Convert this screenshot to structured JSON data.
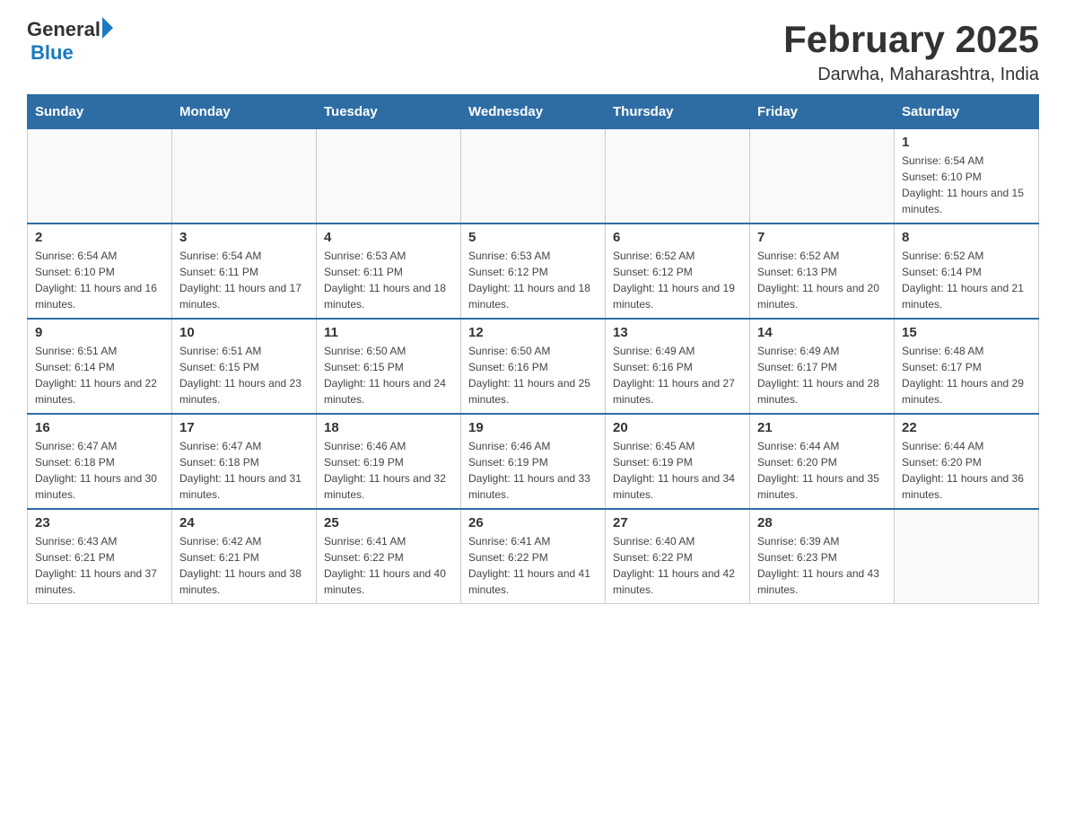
{
  "header": {
    "logo": {
      "text_general": "General",
      "text_blue": "Blue"
    },
    "title": "February 2025",
    "location": "Darwha, Maharashtra, India"
  },
  "days_of_week": [
    "Sunday",
    "Monday",
    "Tuesday",
    "Wednesday",
    "Thursday",
    "Friday",
    "Saturday"
  ],
  "weeks": [
    [
      {
        "day": "",
        "info": ""
      },
      {
        "day": "",
        "info": ""
      },
      {
        "day": "",
        "info": ""
      },
      {
        "day": "",
        "info": ""
      },
      {
        "day": "",
        "info": ""
      },
      {
        "day": "",
        "info": ""
      },
      {
        "day": "1",
        "info": "Sunrise: 6:54 AM\nSunset: 6:10 PM\nDaylight: 11 hours and 15 minutes."
      }
    ],
    [
      {
        "day": "2",
        "info": "Sunrise: 6:54 AM\nSunset: 6:10 PM\nDaylight: 11 hours and 16 minutes."
      },
      {
        "day": "3",
        "info": "Sunrise: 6:54 AM\nSunset: 6:11 PM\nDaylight: 11 hours and 17 minutes."
      },
      {
        "day": "4",
        "info": "Sunrise: 6:53 AM\nSunset: 6:11 PM\nDaylight: 11 hours and 18 minutes."
      },
      {
        "day": "5",
        "info": "Sunrise: 6:53 AM\nSunset: 6:12 PM\nDaylight: 11 hours and 18 minutes."
      },
      {
        "day": "6",
        "info": "Sunrise: 6:52 AM\nSunset: 6:12 PM\nDaylight: 11 hours and 19 minutes."
      },
      {
        "day": "7",
        "info": "Sunrise: 6:52 AM\nSunset: 6:13 PM\nDaylight: 11 hours and 20 minutes."
      },
      {
        "day": "8",
        "info": "Sunrise: 6:52 AM\nSunset: 6:14 PM\nDaylight: 11 hours and 21 minutes."
      }
    ],
    [
      {
        "day": "9",
        "info": "Sunrise: 6:51 AM\nSunset: 6:14 PM\nDaylight: 11 hours and 22 minutes."
      },
      {
        "day": "10",
        "info": "Sunrise: 6:51 AM\nSunset: 6:15 PM\nDaylight: 11 hours and 23 minutes."
      },
      {
        "day": "11",
        "info": "Sunrise: 6:50 AM\nSunset: 6:15 PM\nDaylight: 11 hours and 24 minutes."
      },
      {
        "day": "12",
        "info": "Sunrise: 6:50 AM\nSunset: 6:16 PM\nDaylight: 11 hours and 25 minutes."
      },
      {
        "day": "13",
        "info": "Sunrise: 6:49 AM\nSunset: 6:16 PM\nDaylight: 11 hours and 27 minutes."
      },
      {
        "day": "14",
        "info": "Sunrise: 6:49 AM\nSunset: 6:17 PM\nDaylight: 11 hours and 28 minutes."
      },
      {
        "day": "15",
        "info": "Sunrise: 6:48 AM\nSunset: 6:17 PM\nDaylight: 11 hours and 29 minutes."
      }
    ],
    [
      {
        "day": "16",
        "info": "Sunrise: 6:47 AM\nSunset: 6:18 PM\nDaylight: 11 hours and 30 minutes."
      },
      {
        "day": "17",
        "info": "Sunrise: 6:47 AM\nSunset: 6:18 PM\nDaylight: 11 hours and 31 minutes."
      },
      {
        "day": "18",
        "info": "Sunrise: 6:46 AM\nSunset: 6:19 PM\nDaylight: 11 hours and 32 minutes."
      },
      {
        "day": "19",
        "info": "Sunrise: 6:46 AM\nSunset: 6:19 PM\nDaylight: 11 hours and 33 minutes."
      },
      {
        "day": "20",
        "info": "Sunrise: 6:45 AM\nSunset: 6:19 PM\nDaylight: 11 hours and 34 minutes."
      },
      {
        "day": "21",
        "info": "Sunrise: 6:44 AM\nSunset: 6:20 PM\nDaylight: 11 hours and 35 minutes."
      },
      {
        "day": "22",
        "info": "Sunrise: 6:44 AM\nSunset: 6:20 PM\nDaylight: 11 hours and 36 minutes."
      }
    ],
    [
      {
        "day": "23",
        "info": "Sunrise: 6:43 AM\nSunset: 6:21 PM\nDaylight: 11 hours and 37 minutes."
      },
      {
        "day": "24",
        "info": "Sunrise: 6:42 AM\nSunset: 6:21 PM\nDaylight: 11 hours and 38 minutes."
      },
      {
        "day": "25",
        "info": "Sunrise: 6:41 AM\nSunset: 6:22 PM\nDaylight: 11 hours and 40 minutes."
      },
      {
        "day": "26",
        "info": "Sunrise: 6:41 AM\nSunset: 6:22 PM\nDaylight: 11 hours and 41 minutes."
      },
      {
        "day": "27",
        "info": "Sunrise: 6:40 AM\nSunset: 6:22 PM\nDaylight: 11 hours and 42 minutes."
      },
      {
        "day": "28",
        "info": "Sunrise: 6:39 AM\nSunset: 6:23 PM\nDaylight: 11 hours and 43 minutes."
      },
      {
        "day": "",
        "info": ""
      }
    ]
  ]
}
